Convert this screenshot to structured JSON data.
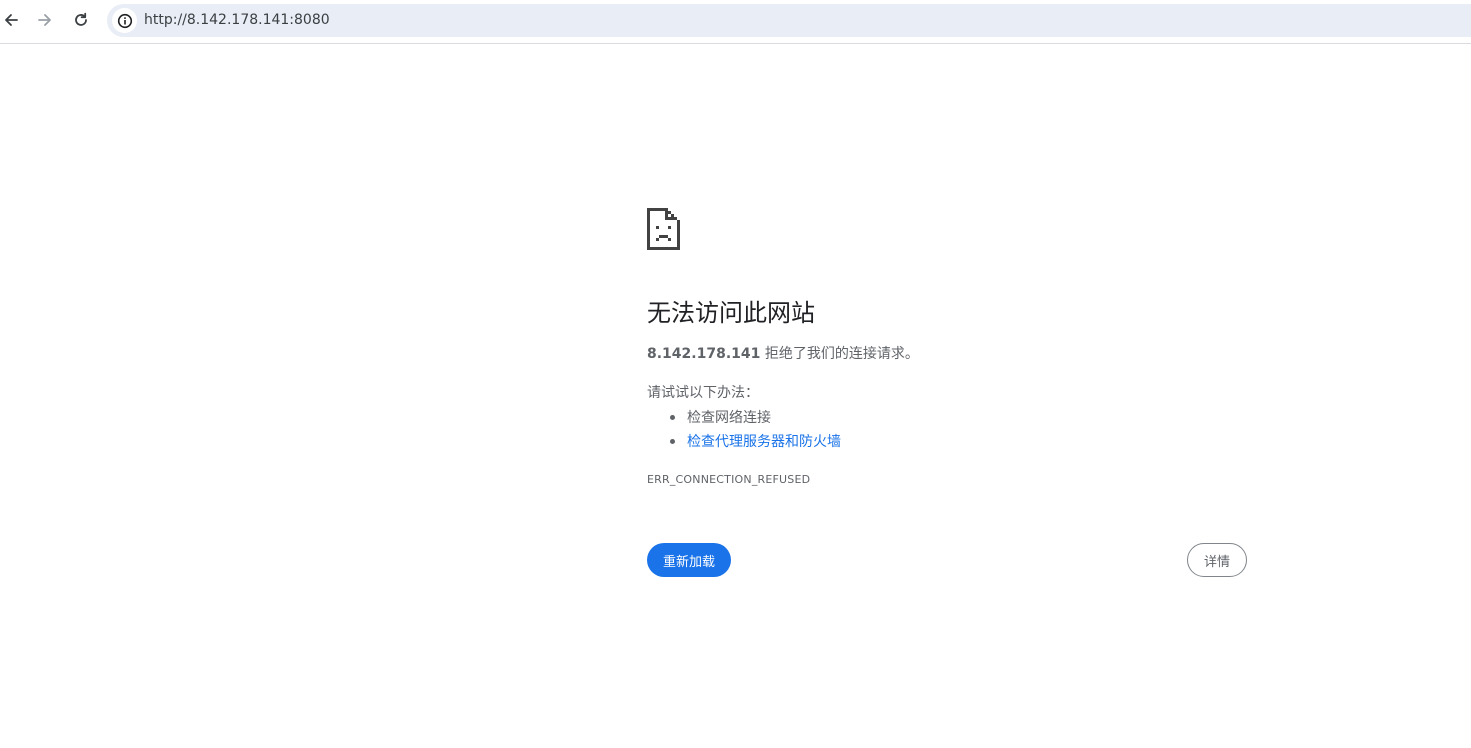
{
  "browser": {
    "url": "http://8.142.178.141:8080",
    "icons": {
      "back": "back-arrow-icon",
      "forward": "forward-arrow-icon",
      "reload": "reload-icon",
      "site_info": "info-icon"
    }
  },
  "error_page": {
    "icon": "sad-page-icon",
    "heading": "无法访问此网站",
    "host": "8.142.178.141",
    "description_suffix": " 拒绝了我们的连接请求。",
    "suggestions_intro": "请试试以下办法：",
    "suggestions": [
      {
        "label": "检查网络连接",
        "is_link": false
      },
      {
        "label": "检查代理服务器和防火墙",
        "is_link": true
      }
    ],
    "error_code": "ERR_CONNECTION_REFUSED",
    "reload_button_label": "重新加载",
    "details_button_label": "详情"
  },
  "colors": {
    "accent": "#1a73e8",
    "omnibox_bg": "#e9edf6",
    "text_secondary": "#5f6368"
  }
}
